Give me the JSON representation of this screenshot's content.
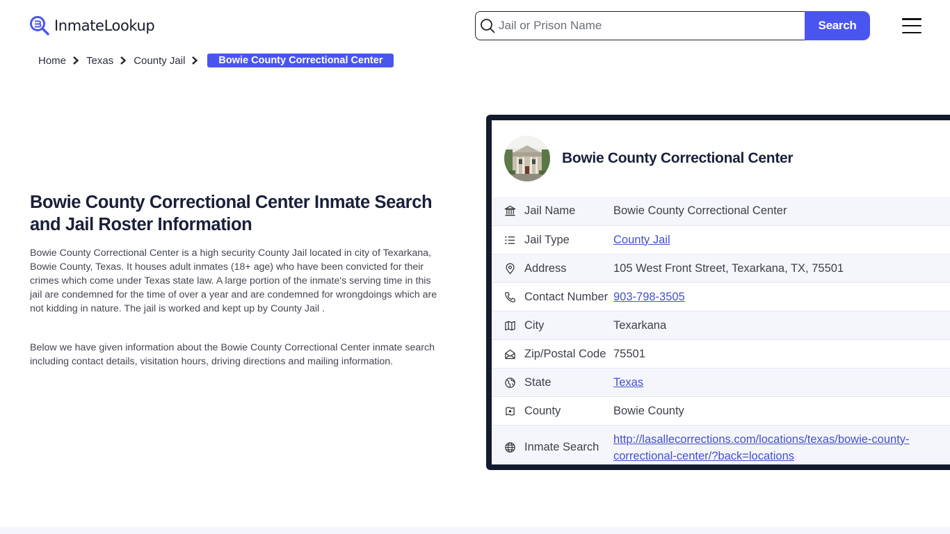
{
  "header": {
    "logo_text": "InmateLookup",
    "search": {
      "placeholder": "Jail or Prison Name",
      "value": "",
      "button_label": "Search"
    },
    "menu_icon": "hamburger-icon"
  },
  "breadcrumb": {
    "items": [
      "Home",
      "Texas",
      "County Jail"
    ],
    "active": "Bowie County Correctional Center"
  },
  "main": {
    "title": "Bowie County Correctional Center Inmate Search and Jail Roster Information",
    "paragraphs": [
      "Bowie County Correctional Center is a high security County Jail located in city of Texarkana, Bowie County, Texas. It houses adult inmates (18+ age) who have been convicted for their crimes which come under Texas state law. A large portion of the inmate's serving time in this jail are condemned for the time of over a year and are condemned for wrongdoings which are not kidding in nature. The jail is worked and kept up by County Jail .",
      "Below we have given information about the Bowie County Correctional Center inmate search including contact details, visitation hours, driving directions and mailing information."
    ]
  },
  "card": {
    "title": "Bowie County Correctional Center",
    "rows": [
      {
        "icon": "building-columns-icon",
        "label": "Jail Name",
        "value": "Bowie County Correctional Center",
        "link": false
      },
      {
        "icon": "list-icon",
        "label": "Jail Type",
        "value": "County Jail",
        "link": true
      },
      {
        "icon": "map-pin-icon",
        "label": "Address",
        "value": "105 West Front Street, Texarkana, TX, 75501",
        "link": false
      },
      {
        "icon": "phone-icon",
        "label": "Contact Number",
        "value": "903-798-3505",
        "link": true
      },
      {
        "icon": "map-icon",
        "label": "City",
        "value": "Texarkana",
        "link": false
      },
      {
        "icon": "mail-open-icon",
        "label": "Zip/Postal Code",
        "value": "75501",
        "link": false
      },
      {
        "icon": "globe-region-icon",
        "label": "State",
        "value": "Texas",
        "link": true
      },
      {
        "icon": "county-map-icon",
        "label": "County",
        "value": "Bowie County",
        "link": false
      },
      {
        "icon": "world-icon",
        "label": "Inmate Search",
        "value": "http://lasallecorrections.com/locations/texas/bowie-county-correctional-center/?back=locations",
        "link": true
      }
    ]
  },
  "colors": {
    "accent": "#4a55f0",
    "card_border": "#131b2e",
    "row_alt": "#f5f6fc",
    "link": "#4350c8"
  }
}
